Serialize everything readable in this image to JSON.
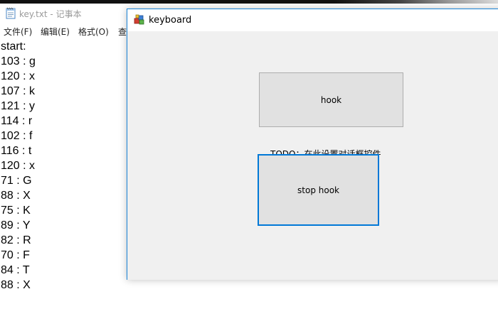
{
  "notepad": {
    "title": "key.txt - 记事本",
    "menu": [
      "文件(F)",
      "编辑(E)",
      "格式(O)",
      "查"
    ],
    "lines": [
      "start:",
      "103 : g",
      "120 : x",
      "107 : k",
      "121 : y",
      "114 : r",
      "102 : f",
      "116 : t",
      "120 : x",
      "71 : G",
      "88 : X",
      "75 : K",
      "89 : Y",
      "82 : R",
      "70 : F",
      "84 : T",
      "88 : X"
    ],
    "icon": "notepad-icon"
  },
  "keyboard_window": {
    "title": "keyboard",
    "icon": "app-icon",
    "hook_button": "hook",
    "stop_hook_button": "stop hook",
    "todo_label": "TODO：在此设置对话框控件。"
  },
  "colors": {
    "window_border": "#1883d7",
    "focus_border": "#0078d7",
    "client_bg": "#f0f0f0",
    "button_bg": "#e1e1e1"
  }
}
